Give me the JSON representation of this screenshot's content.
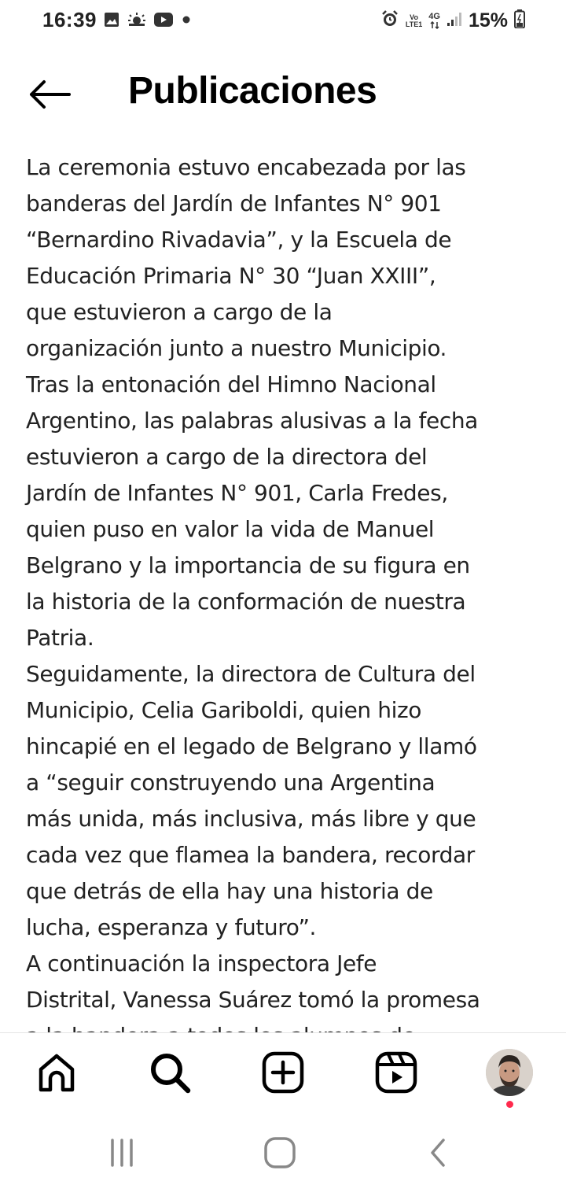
{
  "status_bar": {
    "time": "16:39",
    "battery": "15%",
    "network_top": "Vo",
    "network_bottom": "LTE1",
    "network_type": "4G",
    "left_icons": [
      "image-icon",
      "weather-icon",
      "youtube-icon",
      "dot-icon"
    ],
    "right_icons": [
      "alarm-icon",
      "signal-icon",
      "battery-icon"
    ]
  },
  "header": {
    "title": "Publicaciones",
    "back_icon": "arrow-left-icon"
  },
  "post": {
    "text": "La ceremonia estuvo encabezada por las\nbanderas del Jardín de Infantes N° 901\n“Bernardino Rivadavia”, y la Escuela de\nEducación Primaria N° 30 “Juan XXIII”,\nque estuvieron a cargo de la\norganización junto a nuestro Municipio.\nTras la entonación del Himno Nacional\nArgentino, las palabras alusivas a la fecha\nestuvieron a cargo de la directora del\nJardín de Infantes N° 901, Carla Fredes,\nquien puso en valor la vida de Manuel\nBelgrano y la importancia de su figura en\nla historia de la conformación de nuestra\nPatria.\nSeguidamente, la directora de Cultura del\nMunicipio, Celia Gariboldi, quien hizo\nhincapié en el legado de Belgrano y llamó\na “seguir construyendo una Argentina\nmás unida, más inclusiva, más libre y que\ncada vez que flamea la bandera, recordar\nque detrás de ella hay una historia de\nlucha, esperanza y futuro”.\nA continuación la inspectora Jefe\nDistrital, Vanessa Suárez tomó la promesa\na la bandera a todos los alumnos de"
  },
  "bottom_nav": {
    "items": [
      "home-icon",
      "search-icon",
      "create-icon",
      "reels-icon",
      "profile-avatar"
    ]
  },
  "system_nav": {
    "items": [
      "recents-icon",
      "home-circle-icon",
      "back-chevron-icon"
    ]
  },
  "colors": {
    "text": "#222222",
    "title": "#000000",
    "notification": "#ff2a4d",
    "system_nav": "#888888"
  }
}
